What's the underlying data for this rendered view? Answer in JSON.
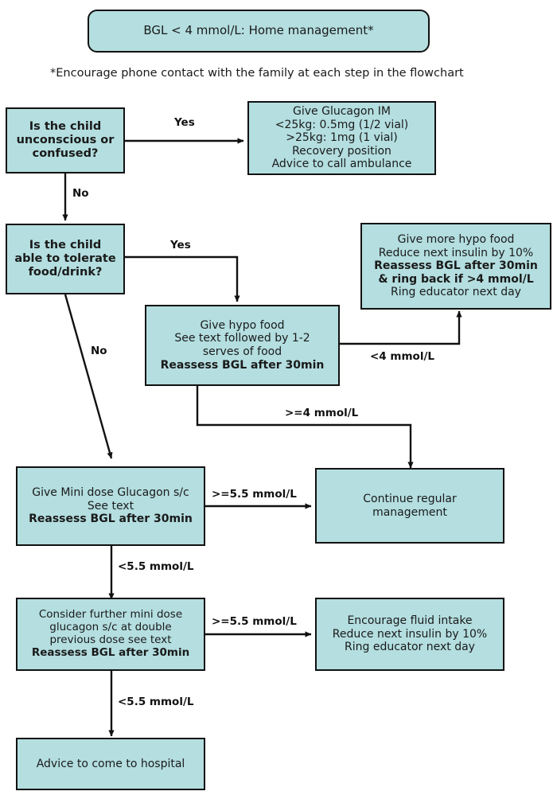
{
  "title": "BGL < 4 mmol/L: Home management*",
  "subtitle": "*Encourage phone contact with the family at each step in the flowchart",
  "colors": {
    "node_fill": "#b4dee0",
    "node_border": "#111111",
    "edge": "#111111",
    "text": "#1a1a1a",
    "background": "#ffffff"
  },
  "nodes": {
    "banner": {
      "lines": [
        "BGL < 4 mmol/L: Home management*"
      ]
    },
    "q_unconscious": {
      "lines": [
        "Is the child",
        "unconscious or",
        "confused?"
      ],
      "bold": [
        true,
        true,
        true
      ]
    },
    "glucagon_im": {
      "lines": [
        "Give Glucagon IM",
        "<25kg: 0.5mg (1/2 vial)",
        ">25kg: 1mg (1 vial)",
        "Recovery position",
        "Advice to call ambulance"
      ],
      "bold": [
        false,
        false,
        false,
        false,
        false
      ]
    },
    "q_tolerate": {
      "lines": [
        "Is the child",
        "able to tolerate",
        "food/drink?"
      ],
      "bold": [
        true,
        true,
        true
      ]
    },
    "hypo_food": {
      "lines": [
        "Give hypo food",
        "See text followed by 1-2",
        "serves of food",
        "Reassess BGL after 30min"
      ],
      "bold": [
        false,
        false,
        false,
        true
      ]
    },
    "more_hypo_food": {
      "lines": [
        "Give more hypo food",
        "Reduce next insulin by 10%",
        "Reassess BGL after 30min",
        "& ring back if >4 mmol/L",
        "Ring educator next day"
      ],
      "bold": [
        false,
        false,
        true,
        true,
        false
      ]
    },
    "mini_dose": {
      "lines": [
        "Give Mini dose Glucagon s/c",
        "See text",
        "Reassess BGL after 30min"
      ],
      "bold": [
        false,
        false,
        true
      ]
    },
    "continue_regular": {
      "lines": [
        "Continue regular",
        "management"
      ],
      "bold": [
        false,
        false
      ]
    },
    "further_mini_dose": {
      "lines": [
        "Consider further mini dose",
        "glucagon s/c at double",
        "previous dose see text",
        "Reassess BGL after 30min"
      ],
      "bold": [
        false,
        false,
        false,
        true
      ]
    },
    "encourage_fluid": {
      "lines": [
        "Encourage fluid intake",
        "Reduce next insulin by 10%",
        "Ring educator next day"
      ],
      "bold": [
        false,
        false,
        false
      ]
    },
    "advice_hospital": {
      "lines": [
        "Advice to come to hospital"
      ],
      "bold": [
        false
      ]
    }
  },
  "edge_labels": {
    "yes_unconscious": "Yes",
    "no_unconscious": "No",
    "yes_tolerate": "Yes",
    "no_tolerate": "No",
    "lt4": "<4 mmol/L",
    "gte4": ">=4 mmol/L",
    "gte55_mini": ">=5.5 mmol/L",
    "lt55_mini": "<5.5 mmol/L",
    "gte55_further": ">=5.5 mmol/L",
    "lt55_further": "<5.5 mmol/L"
  }
}
